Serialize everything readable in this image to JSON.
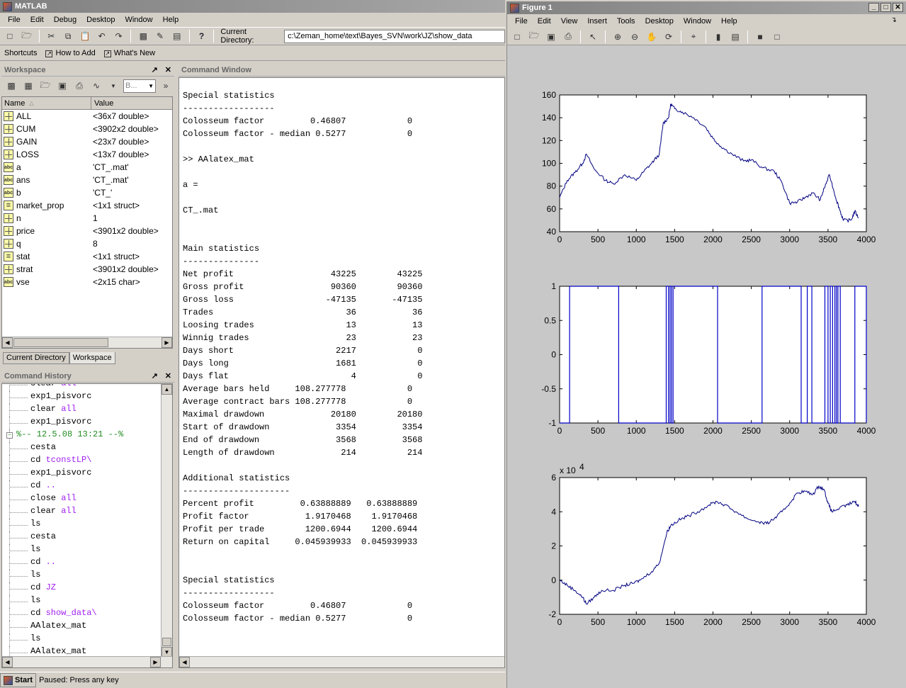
{
  "matlab": {
    "title": "MATLAB",
    "menu": [
      "File",
      "Edit",
      "Debug",
      "Desktop",
      "Window",
      "Help"
    ],
    "current_dir_label": "Current Directory:",
    "current_dir_value": "c:\\Zeman_home\\text\\Bayes_SVN\\work\\JZ\\show_data",
    "shortcuts": [
      "Shortcuts",
      "How to Add",
      "What's New"
    ]
  },
  "workspace": {
    "title": "Workspace",
    "combo": "B...",
    "col_name": "Name",
    "col_value": "Value",
    "rows": [
      {
        "name": "ALL",
        "value": "<36x7 double>",
        "kind": "grid"
      },
      {
        "name": "CUM",
        "value": "<3902x2 double>",
        "kind": "grid"
      },
      {
        "name": "GAIN",
        "value": "<23x7 double>",
        "kind": "grid"
      },
      {
        "name": "LOSS",
        "value": "<13x7 double>",
        "kind": "grid"
      },
      {
        "name": "a",
        "value": "'CT_.mat'",
        "kind": "abc"
      },
      {
        "name": "ans",
        "value": "'CT_.mat'",
        "kind": "abc"
      },
      {
        "name": "b",
        "value": "'CT_'",
        "kind": "abc"
      },
      {
        "name": "market_prop",
        "value": "<1x1 struct>",
        "kind": "struct"
      },
      {
        "name": "n",
        "value": "1",
        "kind": "grid"
      },
      {
        "name": "price",
        "value": "<3901x2 double>",
        "kind": "grid"
      },
      {
        "name": "q",
        "value": "8",
        "kind": "grid"
      },
      {
        "name": "stat",
        "value": "<1x1 struct>",
        "kind": "struct"
      },
      {
        "name": "strat",
        "value": "<3901x2 double>",
        "kind": "grid"
      },
      {
        "name": "vse",
        "value": "<2x15 char>",
        "kind": "abc"
      }
    ],
    "tabs": [
      "Current Directory",
      "Workspace"
    ]
  },
  "history": {
    "title": "Command History",
    "items": [
      {
        "t": "clear all",
        "ind": 1
      },
      {
        "t": "exp1_pisvorc",
        "ind": 1
      },
      {
        "t": "clear all",
        "ind": 1
      },
      {
        "t": "exp1_pisvorc",
        "ind": 1
      },
      {
        "t": "%-- 12.5.08 13:21 --%",
        "ind": 0
      },
      {
        "t": "cesta",
        "ind": 1
      },
      {
        "t": "cd tconstLP\\",
        "ind": 1
      },
      {
        "t": "exp1_pisvorc",
        "ind": 1
      },
      {
        "t": "cd ..",
        "ind": 1
      },
      {
        "t": "close all",
        "ind": 1
      },
      {
        "t": "clear all",
        "ind": 1
      },
      {
        "t": "ls",
        "ind": 1
      },
      {
        "t": "cesta",
        "ind": 1
      },
      {
        "t": "ls",
        "ind": 1
      },
      {
        "t": "cd ..",
        "ind": 1
      },
      {
        "t": "ls",
        "ind": 1
      },
      {
        "t": "cd JZ",
        "ind": 1
      },
      {
        "t": "ls",
        "ind": 1
      },
      {
        "t": "cd show_data\\",
        "ind": 1
      },
      {
        "t": "AAlatex_mat",
        "ind": 1
      },
      {
        "t": "ls",
        "ind": 1
      },
      {
        "t": "AAlatex_mat",
        "ind": 1
      }
    ]
  },
  "command_window": {
    "title": "Command Window",
    "lines": [
      "",
      "Special statistics",
      "------------------",
      "Colosseum factor         0.46807            0",
      "Colosseum factor - median 0.5277            0",
      "",
      ">> AAlatex_mat",
      "",
      "a =",
      "",
      "CT_.mat",
      "",
      "",
      "Main statistics",
      "---------------",
      "Net profit                   43225        43225",
      "Gross profit                 90360        90360",
      "Gross loss                  -47135       -47135",
      "Trades                          36           36",
      "Loosing trades                  13           13",
      "Winnig trades                   23           23",
      "Days short                    2217            0",
      "Days long                     1681            0",
      "Days flat                        4            0",
      "Average bars held     108.277778            0",
      "Average contract bars 108.277778            0",
      "Maximal drawdown             20180        20180",
      "Start of drawdown             3354         3354",
      "End of drawdown               3568         3568",
      "Length of drawdown             214          214",
      "",
      "Additional statistics",
      "---------------------",
      "Percent profit         0.63888889   0.63888889",
      "Profit factor           1.9170468    1.9170468",
      "Profit per trade        1200.6944    1200.6944",
      "Return on capital     0.045939933  0.045939933",
      "",
      "",
      "Special statistics",
      "------------------",
      "Colosseum factor         0.46807            0",
      "Colosseum factor - median 0.5277            0"
    ]
  },
  "status": {
    "start": "Start",
    "message": "Paused: Press any key"
  },
  "figure": {
    "title": "Figure 1",
    "menu": [
      "File",
      "Edit",
      "View",
      "Insert",
      "Tools",
      "Desktop",
      "Window",
      "Help"
    ],
    "line_color": "#000080"
  },
  "chart_data": [
    {
      "type": "line",
      "xlim": [
        0,
        4000
      ],
      "ylim": [
        40,
        160
      ],
      "xticks": [
        0,
        500,
        1000,
        1500,
        2000,
        2500,
        3000,
        3500,
        4000
      ],
      "yticks": [
        40,
        60,
        80,
        100,
        120,
        140,
        160
      ],
      "x": [
        0,
        100,
        200,
        300,
        350,
        450,
        600,
        700,
        850,
        1000,
        1100,
        1200,
        1300,
        1350,
        1420,
        1450,
        1500,
        1600,
        1750,
        1900,
        2000,
        2100,
        2250,
        2400,
        2500,
        2650,
        2800,
        2900,
        3000,
        3100,
        3200,
        3300,
        3400,
        3450,
        3520,
        3600,
        3650,
        3700,
        3800,
        3850,
        3900
      ],
      "y": [
        70,
        85,
        92,
        100,
        108,
        95,
        85,
        82,
        90,
        85,
        93,
        100,
        108,
        135,
        140,
        152,
        148,
        145,
        140,
        132,
        122,
        115,
        108,
        102,
        103,
        96,
        93,
        83,
        65,
        66,
        70,
        74,
        68,
        78,
        90,
        70,
        60,
        50,
        50,
        58,
        52
      ]
    },
    {
      "type": "line",
      "xlim": [
        0,
        4000
      ],
      "ylim": [
        -1,
        1
      ],
      "xticks": [
        0,
        500,
        1000,
        1500,
        2000,
        2500,
        3000,
        3500,
        4000
      ],
      "yticks": [
        -1,
        -0.5,
        0,
        0.5,
        1
      ],
      "switch_x": [
        130,
        770,
        1390,
        1420,
        1440,
        1460,
        1480,
        2060,
        2640,
        3150,
        3230,
        3290,
        3460,
        3500,
        3530,
        3560,
        3590,
        3610,
        3630,
        3660,
        3850,
        4000
      ]
    },
    {
      "type": "line",
      "xlim": [
        0,
        4000
      ],
      "ylim": [
        -20000,
        60000
      ],
      "scale_label": "x 10",
      "scale_exp": "4",
      "xticks": [
        0,
        500,
        1000,
        1500,
        2000,
        2500,
        3000,
        3500,
        4000
      ],
      "yticks": [
        -2,
        0,
        2,
        4,
        6
      ],
      "x": [
        0,
        100,
        200,
        300,
        350,
        450,
        550,
        700,
        850,
        950,
        1050,
        1200,
        1300,
        1400,
        1450,
        1550,
        1650,
        1800,
        1950,
        2050,
        2150,
        2300,
        2450,
        2600,
        2700,
        2800,
        2900,
        3000,
        3100,
        3200,
        3300,
        3380,
        3450,
        3500,
        3550,
        3650,
        3750,
        3850,
        3900
      ],
      "y": [
        0,
        -3000,
        -6000,
        -10000,
        -14000,
        -10000,
        -6000,
        -6000,
        -3000,
        -2000,
        0,
        5000,
        10000,
        28000,
        32000,
        35000,
        37000,
        40000,
        44000,
        46000,
        44000,
        40000,
        36000,
        34000,
        33000,
        36000,
        40000,
        45000,
        51000,
        52000,
        50000,
        55000,
        53000,
        45000,
        40000,
        42000,
        44000,
        46000,
        43000
      ]
    }
  ]
}
